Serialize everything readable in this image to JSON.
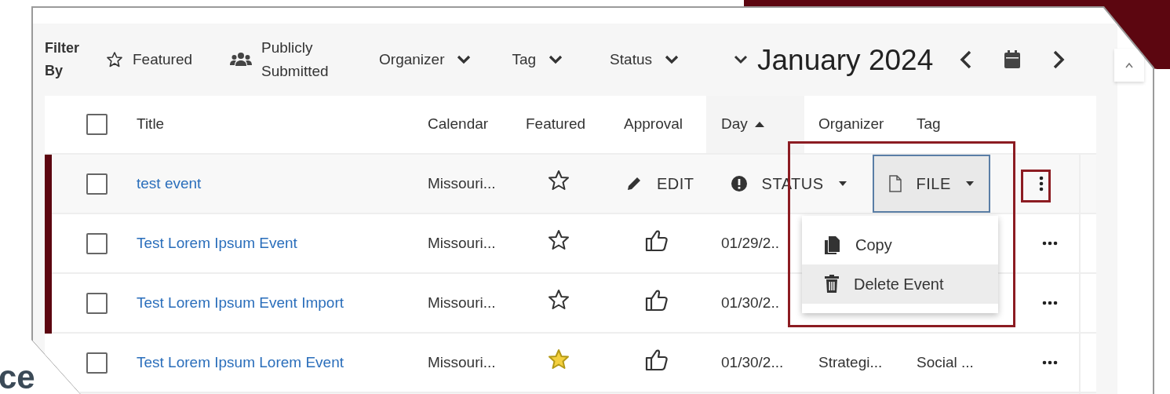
{
  "backdrop_text": "ce",
  "filter_bar": {
    "label": "Filter By",
    "filters": [
      {
        "kind": "toggle",
        "label": "Featured"
      },
      {
        "kind": "toggle",
        "label": "Publicly Submitted"
      },
      {
        "kind": "dropdown",
        "label": "Organizer"
      },
      {
        "kind": "dropdown",
        "label": "Tag"
      },
      {
        "kind": "dropdown",
        "label": "Status"
      }
    ]
  },
  "month_nav": {
    "label": "January 2024"
  },
  "table": {
    "header_checkbox": {
      "checked": false
    },
    "columns": [
      {
        "label": "Title",
        "sorted": false
      },
      {
        "label": "Calendar",
        "sorted": false
      },
      {
        "label": "Featured",
        "sorted": false
      },
      {
        "label": "Approval",
        "sorted": false
      },
      {
        "label": "Day",
        "sorted": true
      },
      {
        "label": "Organizer",
        "sorted": false
      },
      {
        "label": "Tag",
        "sorted": false
      }
    ],
    "rows": [
      {
        "kind": "actions",
        "checked": false,
        "flagged": true,
        "title": "test event",
        "calendar": "Missouri...",
        "featured": false
      },
      {
        "kind": "data",
        "checked": false,
        "flagged": true,
        "title": "Test Lorem Ipsum Event",
        "calendar": "Missouri...",
        "featured": false,
        "day": "01/29/2.."
      },
      {
        "kind": "data",
        "checked": false,
        "flagged": true,
        "title": "Test Lorem Ipsum Event Import",
        "calendar": "Missouri...",
        "featured": false,
        "day": "01/30/2.."
      },
      {
        "kind": "data",
        "checked": false,
        "flagged": false,
        "title": "Test Lorem Ipsum Lorem Event",
        "calendar": "Missouri...",
        "featured": true,
        "day": "01/30/2...",
        "organizer": "Strategi...",
        "tag": "Social ..."
      }
    ]
  },
  "row_actions": [
    {
      "kind": "edit",
      "label": "EDIT",
      "pressed": false
    },
    {
      "kind": "status",
      "label": "STATUS",
      "pressed": false
    },
    {
      "kind": "file",
      "label": "FILE",
      "pressed": true
    }
  ],
  "file_menu": {
    "items": [
      {
        "kind": "copy",
        "label": "Copy",
        "hovered": false
      },
      {
        "kind": "delete",
        "label": "Delete Event",
        "hovered": true
      }
    ]
  }
}
